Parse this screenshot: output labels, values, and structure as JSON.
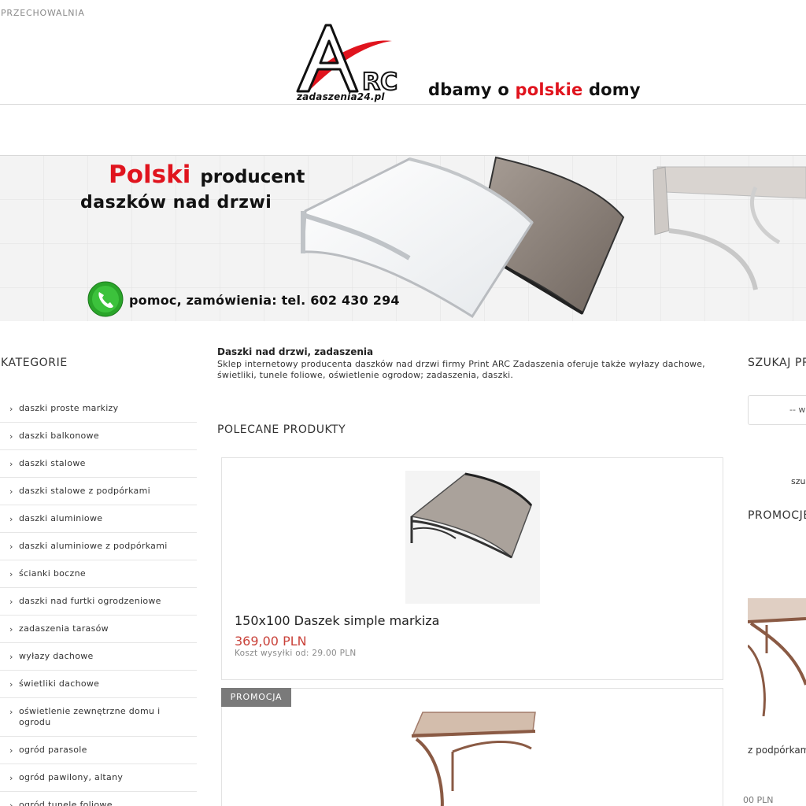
{
  "header": {
    "top_label": "PRZECHOWALNIA",
    "logo_text": "ARC",
    "logo_domain": "zadaszenia24.pl",
    "slogan_pre": "dbamy o ",
    "slogan_highlight": "polskie",
    "slogan_post": " domy"
  },
  "banner": {
    "line1_red": "Polski",
    "line1_dark": "producent",
    "line2": "daszków nad drzwi",
    "phone_text": "pomoc, zamówienia: tel. 602 430 294"
  },
  "sidebar": {
    "title": "KATEGORIE",
    "items": [
      {
        "label": "daszki proste markizy"
      },
      {
        "label": "daszki balkonowe"
      },
      {
        "label": "daszki stalowe"
      },
      {
        "label": "daszki stalowe z podpórkami"
      },
      {
        "label": "daszki aluminiowe"
      },
      {
        "label": "daszki aluminiowe z podpórkami"
      },
      {
        "label": "ścianki boczne"
      },
      {
        "label": "daszki nad furtki ogrodzeniowe"
      },
      {
        "label": "zadaszenia tarasów"
      },
      {
        "label": "wyłazy dachowe"
      },
      {
        "label": "świetliki dachowe"
      },
      {
        "label": "oświetlenie zewnętrzne domu i ogrodu"
      },
      {
        "label": "ogród parasole"
      },
      {
        "label": "ogród pawilony, altany"
      },
      {
        "label": "ogród tunele foliowe"
      }
    ]
  },
  "main": {
    "intro_title": "Daszki nad drzwi, zadaszenia",
    "intro_text": "Sklep internetowy producenta daszków nad drzwi firmy Print ARC Zadaszenia oferuje także wyłazy dachowe, świetliki, tunele foliowe, oświetlenie ogrodow; zadaszenia, daszki.",
    "featured_title": "POLECANE PRODUKTY",
    "products": [
      {
        "name": "150x100 Daszek simple markiza",
        "price": "369,00 PLN",
        "shipping": "Koszt wysyłki od: 29.00 PLN"
      },
      {
        "badge": "PROMOCJA"
      }
    ]
  },
  "right": {
    "search_title": "SZUKAJ PR",
    "search_select": "-- w",
    "search_link": "szu",
    "promo_title": "PROMOCJE",
    "side_product_name": "z podpórkam",
    "side_product_price": "00 PLN"
  },
  "colors": {
    "brand_red": "#e0141e",
    "price_red": "#c9423a",
    "badge_gray": "#7a7a7a",
    "phone_green": "#2aa52a"
  }
}
